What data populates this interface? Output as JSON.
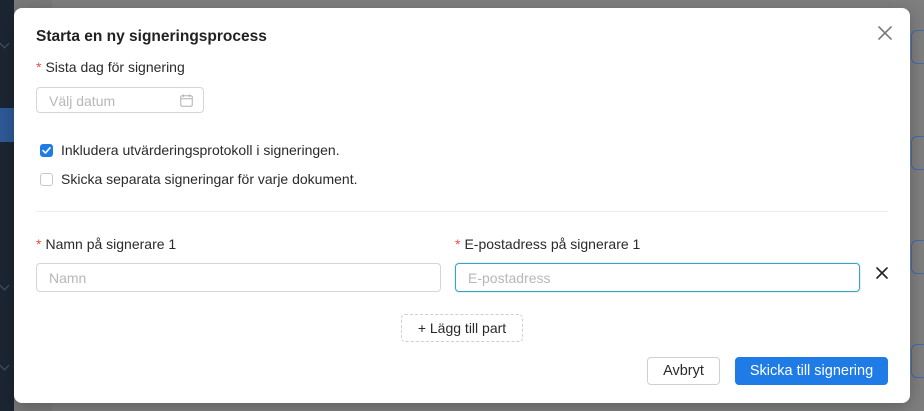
{
  "colors": {
    "accent": "#1f7be6",
    "required": "#e0543f",
    "focus_border": "#3aa3c4"
  },
  "modal": {
    "title": "Starta en ny signeringsprocess",
    "close_icon": "close-icon",
    "deadline": {
      "required_mark": "*",
      "label": "Sista dag för signering",
      "placeholder": "Välj datum",
      "icon": "calendar-icon"
    },
    "options": [
      {
        "label": "Inkludera utvärderingsprotokoll i signeringen.",
        "checked": true
      },
      {
        "label": "Skicka separata signeringar för varje dokument.",
        "checked": false
      }
    ],
    "signer": {
      "name_required_mark": "*",
      "name_label": "Namn på signerare 1",
      "name_placeholder": "Namn",
      "email_required_mark": "*",
      "email_label": "E-postadress på signerare 1",
      "email_placeholder": "E-postadress",
      "remove_icon": "close-icon"
    },
    "add_party_label": "+ Lägg till part",
    "cancel_label": "Avbryt",
    "submit_label": "Skicka till signering"
  }
}
